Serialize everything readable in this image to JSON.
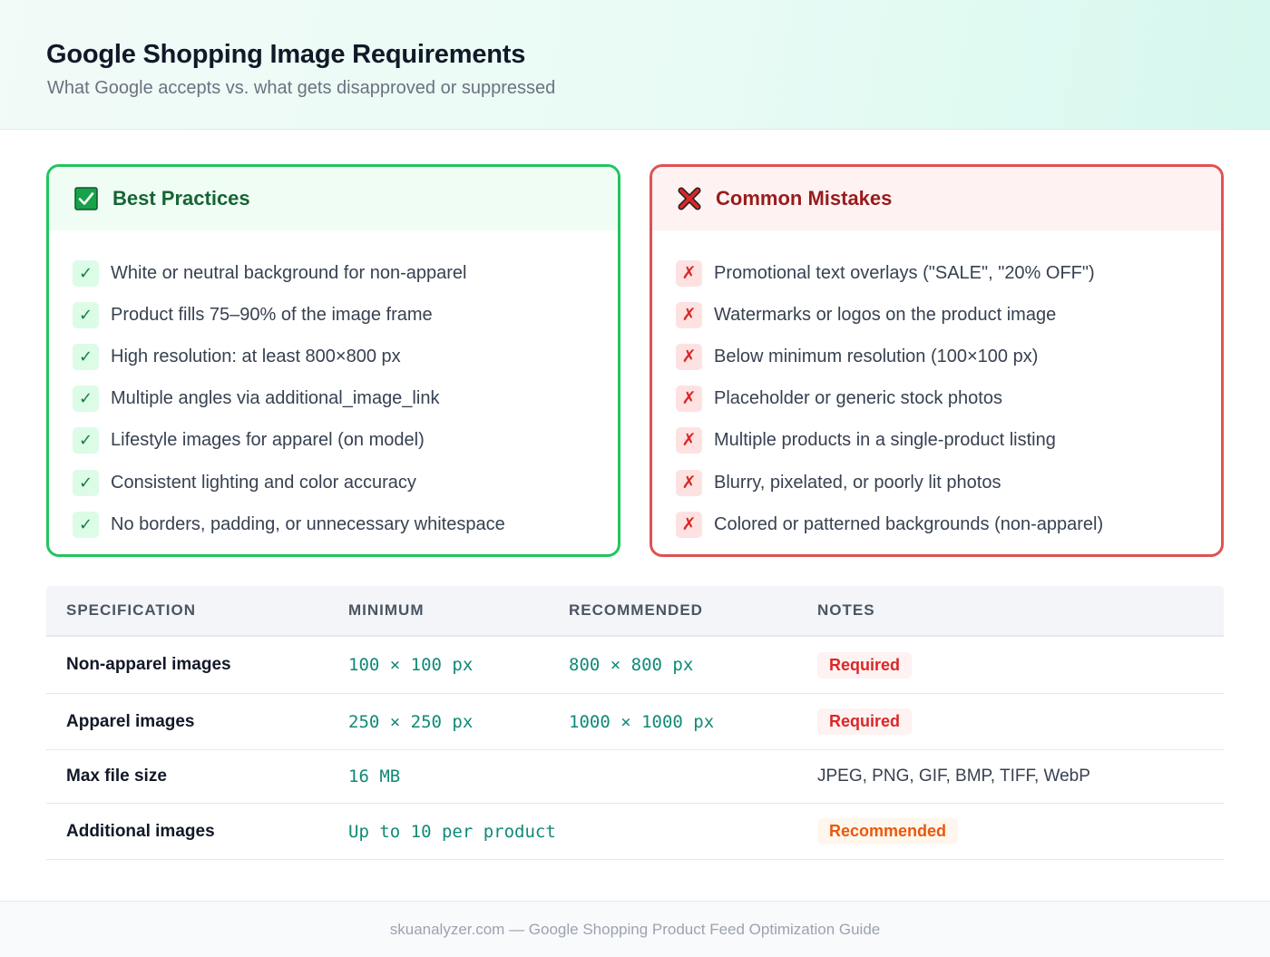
{
  "header": {
    "title": "Google Shopping Image Requirements",
    "subtitle": "What Google accepts vs. what gets disapproved or suppressed"
  },
  "best_practices": {
    "title": "Best Practices",
    "icon": "checkbox-check-icon",
    "accent": "#22c55e",
    "items": [
      "White or neutral background for non-apparel",
      "Product fills 75–90% of the image frame",
      "High resolution: at least 800×800 px",
      "Multiple angles via additional_image_link",
      "Lifestyle images for apparel (on model)",
      "Consistent lighting and color accuracy",
      "No borders, padding, or unnecessary whitespace"
    ]
  },
  "common_mistakes": {
    "title": "Common Mistakes",
    "icon": "cross-mark-icon",
    "accent": "#e05252",
    "items": [
      "Promotional text overlays (\"SALE\", \"20% OFF\")",
      "Watermarks or logos on the product image",
      "Below minimum resolution (100×100 px)",
      "Placeholder or generic stock photos",
      "Multiple products in a single-product listing",
      "Blurry, pixelated, or poorly lit photos",
      "Colored or patterned backgrounds (non-apparel)"
    ]
  },
  "marks": {
    "check": "✓",
    "cross": "✗"
  },
  "table": {
    "headers": [
      "SPECIFICATION",
      "MINIMUM",
      "RECOMMENDED",
      "NOTES"
    ],
    "rows": [
      {
        "spec": "Non-apparel images",
        "minimum": "100 × 100 px",
        "recommended": "800 × 800 px",
        "notes": "Required",
        "notes_type": "badge-required"
      },
      {
        "spec": "Apparel images",
        "minimum": "250 × 250 px",
        "recommended": "1000 × 1000 px",
        "notes": "Required",
        "notes_type": "badge-required"
      },
      {
        "spec": "Max file size",
        "minimum": "16 MB",
        "recommended": "",
        "notes": "JPEG, PNG, GIF, BMP, TIFF, WebP",
        "notes_type": "text"
      },
      {
        "spec": "Additional images",
        "minimum": "Up to 10 per product",
        "recommended": "",
        "notes": "Recommended",
        "notes_type": "badge-recommended"
      }
    ]
  },
  "footer": {
    "text": "skuanalyzer.com — Google Shopping Product Feed Optimization Guide"
  }
}
